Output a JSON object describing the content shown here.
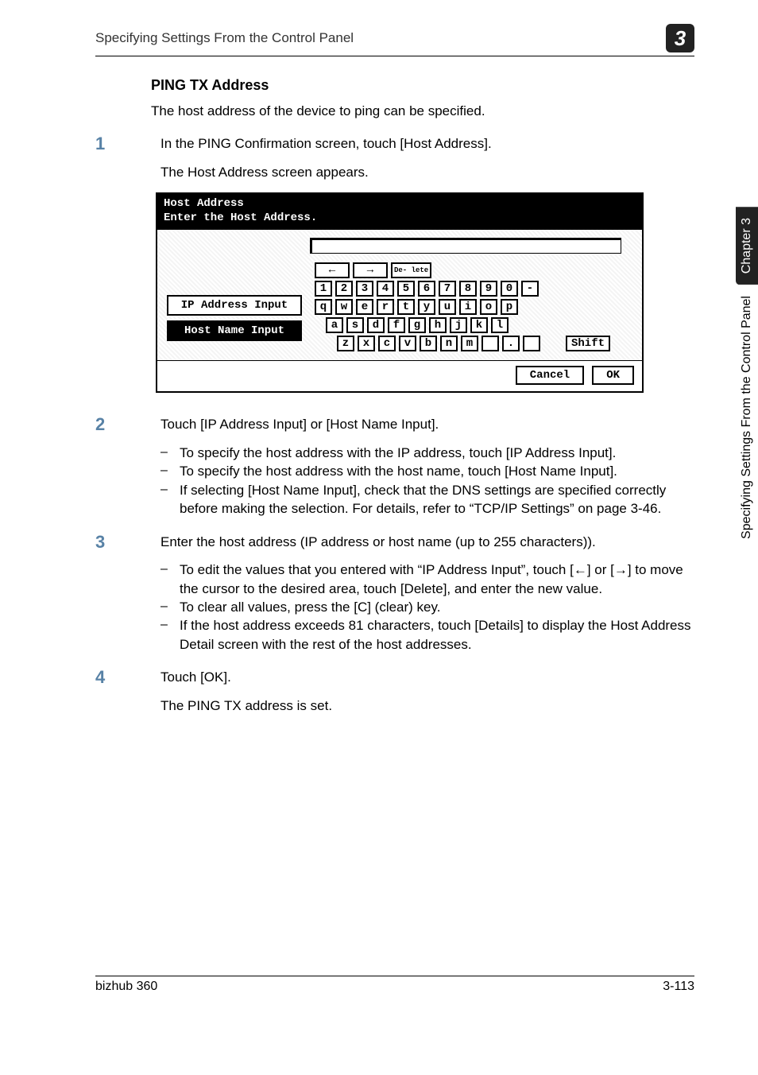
{
  "header": {
    "title": "Specifying Settings From the Control Panel",
    "chapter_num": "3"
  },
  "side": {
    "dark": "Chapter 3",
    "light": "Specifying Settings From the Control Panel"
  },
  "section_title": "PING TX Address",
  "intro": "The host address of the device to ping can be specified.",
  "steps": [
    {
      "num": "1",
      "text": "In the PING Confirmation screen, touch [Host Address].",
      "sub": "The Host Address screen appears."
    },
    {
      "num": "2",
      "text": "Touch [IP Address Input] or [Host Name Input].",
      "bullets": [
        "To specify the host address with the IP address, touch [IP Address Input].",
        "To specify the host address with the host name, touch [Host Name Input].",
        "If selecting [Host Name Input], check that the DNS settings are specified correctly before making the selection. For details, refer to “TCP/IP Settings” on page 3-46."
      ]
    },
    {
      "num": "3",
      "text": "Enter the host address (IP address or host name (up to 255 characters)).",
      "bullets": [
        "To edit the values that you entered with “IP Address Input”, touch [←] or [→] to move the cursor to the desired area, touch [Delete], and enter the new value.",
        "To clear all values, press the [C] (clear) key.",
        "If the host address exceeds 81 characters, touch [Details] to display the Host Address Detail screen with the rest of the host addresses."
      ]
    },
    {
      "num": "4",
      "text": "Touch [OK].",
      "sub": "The PING TX address is set."
    }
  ],
  "screenshot": {
    "title": "Host Address",
    "subtitle": "Enter the Host Address.",
    "ip_btn": "IP Address Input",
    "host_btn": "Host Name Input",
    "delete": "De-\nlete",
    "arrow_left": "←",
    "arrow_right": "→",
    "row_num": [
      "1",
      "2",
      "3",
      "4",
      "5",
      "6",
      "7",
      "8",
      "9",
      "0",
      "-"
    ],
    "row_q": [
      "q",
      "w",
      "e",
      "r",
      "t",
      "y",
      "u",
      "i",
      "o",
      "p"
    ],
    "row_a": [
      "a",
      "s",
      "d",
      "f",
      "g",
      "h",
      "j",
      "k",
      "l"
    ],
    "row_z": [
      "z",
      "x",
      "c",
      "v",
      "b",
      "n",
      "m",
      "",
      ".",
      ""
    ],
    "shift": "Shift",
    "cancel": "Cancel",
    "ok": "OK"
  },
  "footer": {
    "left": "bizhub 360",
    "right": "3-113"
  }
}
